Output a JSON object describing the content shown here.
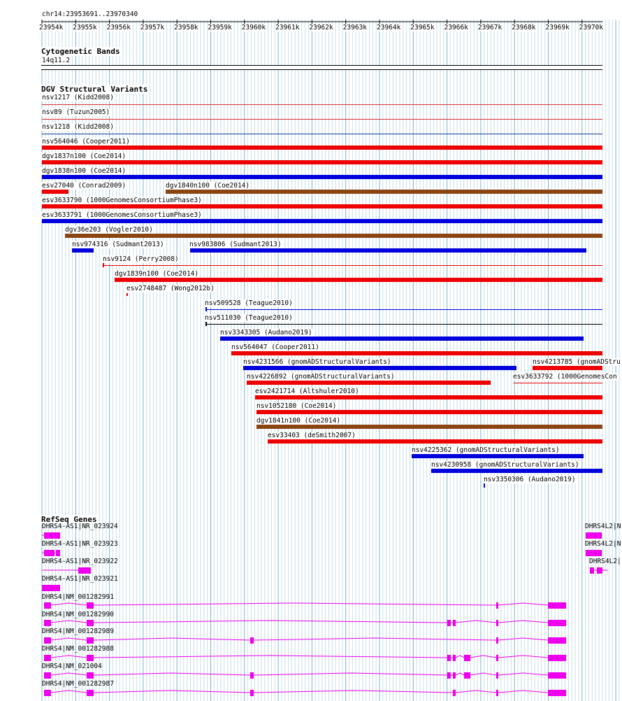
{
  "coords": "chr14:23953691..23970340",
  "ruler_ticks": [
    "23954k",
    "23955k",
    "23956k",
    "23957k",
    "23958k",
    "23959k",
    "23960k",
    "23961k",
    "23962k",
    "23963k",
    "23964k",
    "23965k",
    "23966k",
    "23967k",
    "23968k",
    "23969k",
    "23970k"
  ],
  "cyto": {
    "title": "Cytogenetic Bands",
    "band": "14q11.2"
  },
  "dgv": {
    "title": "DGV Structural Variants",
    "items": [
      {
        "label": "nsv1217 (Kidd2008)",
        "color": "#e03030",
        "kind": "line"
      },
      {
        "label": "nsv89 (Tuzun2005)",
        "color": "#e03030",
        "kind": "line"
      },
      {
        "label": "nsv1218 (Kidd2008)",
        "color": "#1a3a9a",
        "kind": "line"
      },
      {
        "label": "nsv564046 (Cooper2011)",
        "color": "#ee0000",
        "kind": "bar"
      },
      {
        "label": "dgv1837n100 (Coe2014)",
        "color": "#ee0000",
        "kind": "bar"
      },
      {
        "label": "dgv1838n100 (Coe2014)",
        "color": "#0000dd",
        "kind": "bar"
      },
      {
        "label": "esv27040 (Conrad2009)",
        "color": "#ee0000",
        "kind": "bar"
      },
      {
        "label": "dgv1840n100 (Coe2014)",
        "color": "#8b4513",
        "kind": "bar"
      },
      {
        "label": "esv3633790 (1000GenomesConsortiumPhase3)",
        "color": "#ee0000",
        "kind": "bar"
      },
      {
        "label": "esv3633791 (1000GenomesConsortiumPhase3)",
        "color": "#0000dd",
        "kind": "bar"
      },
      {
        "label": "dgv36e203 (Vogler2010)",
        "color": "#8b4513",
        "kind": "bar"
      },
      {
        "label": "nsv974316 (Sudmant2013)",
        "color": "#0000dd",
        "kind": "bar"
      },
      {
        "label": "nsv983806 (Sudmant2013)",
        "color": "#0000dd",
        "kind": "bar"
      },
      {
        "label": "nsv9124 (Perry2008)",
        "color": "#ee0000",
        "kind": "line"
      },
      {
        "label": "dgv1839n100 (Coe2014)",
        "color": "#ee0000",
        "kind": "bar"
      },
      {
        "label": "esv2748487 (Wong2012b)",
        "color": "#ee0000",
        "kind": "tick"
      },
      {
        "label": "nsv509528 (Teague2010)",
        "color": "#0000dd",
        "kind": "line"
      },
      {
        "label": "nsv511030 (Teague2010)",
        "color": "#000000",
        "kind": "line"
      },
      {
        "label": "nsv3343305 (Audano2019)",
        "color": "#0000dd",
        "kind": "bar"
      },
      {
        "label": "nsv564047 (Cooper2011)",
        "color": "#ee0000",
        "kind": "bar"
      },
      {
        "label": "nsv4231566 (gnomADStructuralVariants)",
        "color": "#0000dd",
        "kind": "bar"
      },
      {
        "label": "nsv4213785 (gnomADStru",
        "color": "#ee0000",
        "kind": "bar"
      },
      {
        "label": "nsv4226892 (gnomADStructuralVariants)",
        "color": "#ee0000",
        "kind": "bar"
      },
      {
        "label": "esv3633792 (1000GenomesCon",
        "color": "#ee0000",
        "kind": "bar"
      },
      {
        "label": "esv2421714 (Altshuler2010)",
        "color": "#ee0000",
        "kind": "bar"
      },
      {
        "label": "nsv1052180 (Coe2014)",
        "color": "#ee0000",
        "kind": "bar"
      },
      {
        "label": "dgv1841n100 (Coe2014)",
        "color": "#8b4513",
        "kind": "bar"
      },
      {
        "label": "esv33403 (deSmith2007)",
        "color": "#ee0000",
        "kind": "bar"
      },
      {
        "label": "nsv4225362 (gnomADStructuralVariants)",
        "color": "#0000dd",
        "kind": "bar"
      },
      {
        "label": "nsv4230958 (gnomADStructuralVariants)",
        "color": "#0000dd",
        "kind": "bar"
      },
      {
        "label": "nsv3350306 (Audano2019)",
        "color": "#0000dd",
        "kind": "tick"
      }
    ]
  },
  "genes": {
    "title": "RefSeq Genes",
    "color": "#ee00ee",
    "items": [
      {
        "label": "DHRS4-AS1|NR_023924"
      },
      {
        "label": "DHRS4-AS1|NR_023923"
      },
      {
        "label": "DHRS4-AS1|NR_023922"
      },
      {
        "label": "DHRS4-AS1|NR_023921"
      },
      {
        "label": "DHRS4|NM_001282991"
      },
      {
        "label": "DHRS4|NM_001282990"
      },
      {
        "label": "DHRS4|NM_001282989"
      },
      {
        "label": "DHRS4|NM_001282988"
      },
      {
        "label": "DHRS4|NM_021004"
      },
      {
        "label": "DHRS4|NM_001282987"
      },
      {
        "label": "DHRS4L2|N"
      },
      {
        "label": "DHRS4L2|N"
      },
      {
        "label": "DHRS4L2|"
      }
    ]
  }
}
